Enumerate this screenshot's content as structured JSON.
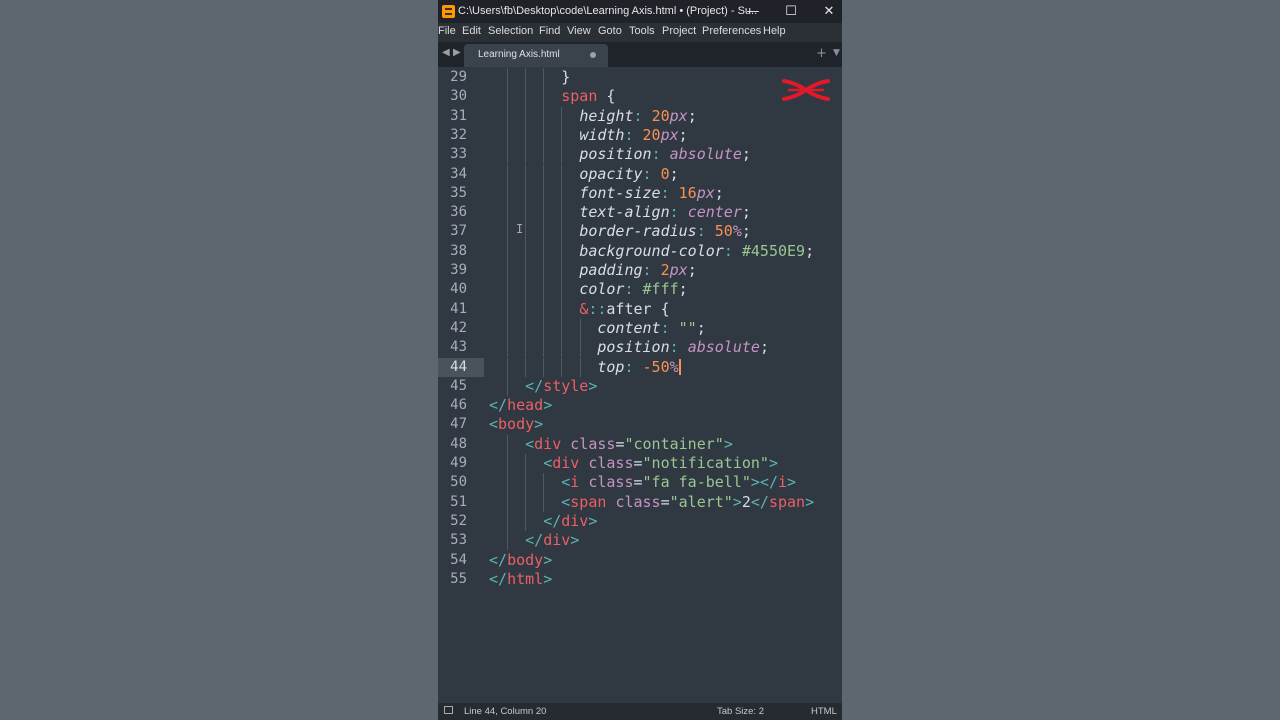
{
  "window": {
    "title": "C:\\Users\\fb\\Desktop\\code\\Learning Axis.html • (Project) - Su...",
    "minimize": "—",
    "maximize": "☐",
    "close": "✕"
  },
  "menu": [
    "File",
    "Edit",
    "Selection",
    "Find",
    "View",
    "Goto",
    "Tools",
    "Project",
    "Preferences",
    "Help"
  ],
  "tab": {
    "label": "Learning Axis.html",
    "prev": "◀",
    "next": "▶",
    "new": "+",
    "dropdown": "▼"
  },
  "editor": {
    "active_line": 44,
    "lines": [
      {
        "n": "29",
        "t": [
          [
            "plain",
            "        }"
          ]
        ]
      },
      {
        "n": "30",
        "t": [
          [
            "plain",
            "        "
          ],
          [
            "tag",
            "span"
          ],
          [
            "plain",
            " {"
          ]
        ]
      },
      {
        "n": "31",
        "t": [
          [
            "plain",
            "          "
          ],
          [
            "prop",
            "height"
          ],
          [
            "punc",
            ":"
          ],
          [
            "plain",
            " "
          ],
          [
            "num",
            "20"
          ],
          [
            "unit",
            "px"
          ],
          [
            "plain",
            ";"
          ]
        ]
      },
      {
        "n": "32",
        "t": [
          [
            "plain",
            "          "
          ],
          [
            "prop",
            "width"
          ],
          [
            "punc",
            ":"
          ],
          [
            "plain",
            " "
          ],
          [
            "num",
            "20"
          ],
          [
            "unit",
            "px"
          ],
          [
            "plain",
            ";"
          ]
        ]
      },
      {
        "n": "33",
        "t": [
          [
            "plain",
            "          "
          ],
          [
            "prop",
            "position"
          ],
          [
            "punc",
            ":"
          ],
          [
            "plain",
            " "
          ],
          [
            "kw",
            "absolute"
          ],
          [
            "plain",
            ";"
          ]
        ]
      },
      {
        "n": "34",
        "t": [
          [
            "plain",
            "          "
          ],
          [
            "prop",
            "opacity"
          ],
          [
            "punc",
            ":"
          ],
          [
            "plain",
            " "
          ],
          [
            "num",
            "0"
          ],
          [
            "plain",
            ";"
          ]
        ]
      },
      {
        "n": "35",
        "t": [
          [
            "plain",
            "          "
          ],
          [
            "prop",
            "font-size"
          ],
          [
            "punc",
            ":"
          ],
          [
            "plain",
            " "
          ],
          [
            "num",
            "16"
          ],
          [
            "unit",
            "px"
          ],
          [
            "plain",
            ";"
          ]
        ]
      },
      {
        "n": "36",
        "t": [
          [
            "plain",
            "          "
          ],
          [
            "prop",
            "text-align"
          ],
          [
            "punc",
            ":"
          ],
          [
            "plain",
            " "
          ],
          [
            "kw",
            "center"
          ],
          [
            "plain",
            ";"
          ]
        ]
      },
      {
        "n": "37",
        "t": [
          [
            "plain",
            "          "
          ],
          [
            "prop",
            "border-radius"
          ],
          [
            "punc",
            ":"
          ],
          [
            "plain",
            " "
          ],
          [
            "num",
            "50"
          ],
          [
            "unit",
            "%"
          ],
          [
            "plain",
            ";"
          ]
        ]
      },
      {
        "n": "38",
        "t": [
          [
            "plain",
            "          "
          ],
          [
            "prop",
            "background-color"
          ],
          [
            "punc",
            ":"
          ],
          [
            "plain",
            " "
          ],
          [
            "hex",
            "#4550E9"
          ],
          [
            "plain",
            ";"
          ]
        ]
      },
      {
        "n": "39",
        "t": [
          [
            "plain",
            "          "
          ],
          [
            "prop",
            "padding"
          ],
          [
            "punc",
            ":"
          ],
          [
            "plain",
            " "
          ],
          [
            "num",
            "2"
          ],
          [
            "unit",
            "px"
          ],
          [
            "plain",
            ";"
          ]
        ]
      },
      {
        "n": "40",
        "t": [
          [
            "plain",
            "          "
          ],
          [
            "prop",
            "color"
          ],
          [
            "punc",
            ":"
          ],
          [
            "plain",
            " "
          ],
          [
            "hex",
            "#fff"
          ],
          [
            "plain",
            ";"
          ]
        ]
      },
      {
        "n": "41",
        "t": [
          [
            "plain",
            "          "
          ],
          [
            "tag",
            "&"
          ],
          [
            "punc",
            "::"
          ],
          [
            "plain",
            "after {"
          ]
        ]
      },
      {
        "n": "42",
        "t": [
          [
            "plain",
            "            "
          ],
          [
            "prop",
            "content"
          ],
          [
            "punc",
            ":"
          ],
          [
            "plain",
            " "
          ],
          [
            "str",
            "\"\""
          ],
          [
            "plain",
            ";"
          ]
        ]
      },
      {
        "n": "43",
        "t": [
          [
            "plain",
            "            "
          ],
          [
            "prop",
            "position"
          ],
          [
            "punc",
            ":"
          ],
          [
            "plain",
            " "
          ],
          [
            "kw",
            "absolute"
          ],
          [
            "plain",
            ";"
          ]
        ]
      },
      {
        "n": "44",
        "t": [
          [
            "plain",
            "            "
          ],
          [
            "prop",
            "top"
          ],
          [
            "punc",
            ":"
          ],
          [
            "plain",
            " "
          ],
          [
            "num",
            "-50"
          ],
          [
            "unit",
            "%"
          ]
        ],
        "cursor": true
      },
      {
        "n": "45",
        "t": [
          [
            "plain",
            "    "
          ],
          [
            "punc",
            "</"
          ],
          [
            "tag",
            "style"
          ],
          [
            "punc",
            ">"
          ]
        ]
      },
      {
        "n": "46",
        "t": [
          [
            "punc",
            "</"
          ],
          [
            "tag",
            "head"
          ],
          [
            "punc",
            ">"
          ]
        ]
      },
      {
        "n": "47",
        "t": [
          [
            "punc",
            "<"
          ],
          [
            "tag",
            "body"
          ],
          [
            "punc",
            ">"
          ]
        ]
      },
      {
        "n": "48",
        "t": [
          [
            "plain",
            "    "
          ],
          [
            "punc",
            "<"
          ],
          [
            "tag",
            "div"
          ],
          [
            "plain",
            " "
          ],
          [
            "attr",
            "class"
          ],
          [
            "plain",
            "="
          ],
          [
            "str",
            "\"container\""
          ],
          [
            "punc",
            ">"
          ]
        ]
      },
      {
        "n": "49",
        "t": [
          [
            "plain",
            "      "
          ],
          [
            "punc",
            "<"
          ],
          [
            "tag",
            "div"
          ],
          [
            "plain",
            " "
          ],
          [
            "attr",
            "class"
          ],
          [
            "plain",
            "="
          ],
          [
            "str",
            "\"notification\""
          ],
          [
            "punc",
            ">"
          ]
        ]
      },
      {
        "n": "50",
        "t": [
          [
            "plain",
            "        "
          ],
          [
            "punc",
            "<"
          ],
          [
            "tag",
            "i"
          ],
          [
            "plain",
            " "
          ],
          [
            "attr",
            "class"
          ],
          [
            "plain",
            "="
          ],
          [
            "str",
            "\"fa fa-bell\""
          ],
          [
            "punc",
            "></"
          ],
          [
            "tag",
            "i"
          ],
          [
            "punc",
            ">"
          ]
        ]
      },
      {
        "n": "51",
        "t": [
          [
            "plain",
            "        "
          ],
          [
            "punc",
            "<"
          ],
          [
            "tag",
            "span"
          ],
          [
            "plain",
            " "
          ],
          [
            "attr",
            "class"
          ],
          [
            "plain",
            "="
          ],
          [
            "str",
            "\"alert\""
          ],
          [
            "punc",
            ">"
          ],
          [
            "plain",
            "2"
          ],
          [
            "punc",
            "</"
          ],
          [
            "tag",
            "span"
          ],
          [
            "punc",
            ">"
          ]
        ]
      },
      {
        "n": "52",
        "t": [
          [
            "plain",
            "      "
          ],
          [
            "punc",
            "</"
          ],
          [
            "tag",
            "div"
          ],
          [
            "punc",
            ">"
          ]
        ]
      },
      {
        "n": "53",
        "t": [
          [
            "plain",
            "    "
          ],
          [
            "punc",
            "</"
          ],
          [
            "tag",
            "div"
          ],
          [
            "punc",
            ">"
          ]
        ]
      },
      {
        "n": "54",
        "t": [
          [
            "punc",
            "</"
          ],
          [
            "tag",
            "body"
          ],
          [
            "punc",
            ">"
          ]
        ]
      },
      {
        "n": "55",
        "t": [
          [
            "punc",
            "</"
          ],
          [
            "tag",
            "html"
          ],
          [
            "punc",
            ">"
          ]
        ]
      }
    ]
  },
  "status": {
    "position": "Line 44, Column 20",
    "tab_size": "Tab Size: 2",
    "syntax": "HTML"
  },
  "colors": {
    "background": "#303841",
    "tag": "#ec5f67",
    "number": "#f99157",
    "keyword": "#c594c5",
    "string": "#99c794",
    "logo": "#e0192b"
  }
}
